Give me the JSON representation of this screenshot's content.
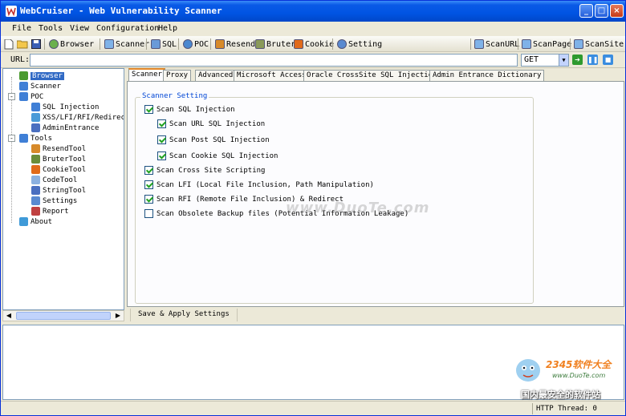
{
  "window": {
    "title": "WebCruiser - Web Vulnerability Scanner",
    "min": "_",
    "max": "□",
    "close": "×"
  },
  "menu": [
    "File",
    "Tools",
    "View",
    "Configuration",
    "Help"
  ],
  "toolbar": {
    "browser": "Browser",
    "scanner": "Scanner",
    "sql": "SQL",
    "poc": "POC",
    "resend": "Resend",
    "bruter": "Bruter",
    "cookie": "Cookie",
    "setting": "Setting",
    "scanurl": "ScanURL",
    "scanpage": "ScanPage",
    "scansite": "ScanSite"
  },
  "urlbar": {
    "label": "URL:",
    "value": "",
    "method": "GET"
  },
  "tree": [
    {
      "label": "Browser",
      "level": 0,
      "selected": true,
      "icon": "browser-icon",
      "color": "#4a9a2e"
    },
    {
      "label": "Scanner",
      "level": 0,
      "icon": "scanner-icon",
      "color": "#3f7fd6"
    },
    {
      "label": "POC",
      "level": 0,
      "expand": "-",
      "icon": "poc-icon",
      "color": "#3f7fd6"
    },
    {
      "label": "SQL Injection",
      "level": 1,
      "icon": "sql-icon",
      "color": "#3f7fd6"
    },
    {
      "label": "XSS/LFI/RFI/Redirect",
      "level": 1,
      "icon": "xss-icon",
      "color": "#4a9ad8"
    },
    {
      "label": "AdminEntrance",
      "level": 1,
      "icon": "admin-icon",
      "color": "#4a6fc0"
    },
    {
      "label": "Tools",
      "level": 0,
      "expand": "-",
      "icon": "tools-icon",
      "color": "#3f7fd6"
    },
    {
      "label": "ResendTool",
      "level": 1,
      "icon": "resend-icon",
      "color": "#d78a2a"
    },
    {
      "label": "BruterTool",
      "level": 1,
      "icon": "bruter-icon",
      "color": "#6a8d3a"
    },
    {
      "label": "CookieTool",
      "level": 1,
      "icon": "cookie-icon",
      "color": "#e06a1a"
    },
    {
      "label": "CodeTool",
      "level": 1,
      "icon": "code-icon",
      "color": "#8bb0e0"
    },
    {
      "label": "StringTool",
      "level": 1,
      "icon": "string-icon",
      "color": "#4a6fc0"
    },
    {
      "label": "Settings",
      "level": 1,
      "icon": "settings-icon",
      "color": "#5a8ad0"
    },
    {
      "label": "Report",
      "level": 1,
      "icon": "report-icon",
      "color": "#c04040"
    },
    {
      "label": "About",
      "level": 0,
      "icon": "about-icon",
      "color": "#3f9ad8"
    }
  ],
  "tabs": [
    "Scanner",
    "Proxy",
    "Advanced",
    "Microsoft Access",
    "Oracle CrossSite SQL Injection",
    "Admin Entrance Dictionary"
  ],
  "scanner_setting": {
    "legend": "Scanner Setting",
    "options": [
      {
        "label": "Scan SQL Injection",
        "checked": true,
        "indent": 0
      },
      {
        "label": "Scan URL SQL Injection",
        "checked": true,
        "indent": 1
      },
      {
        "label": "Scan Post SQL Injection",
        "checked": true,
        "indent": 1
      },
      {
        "label": "Scan Cookie SQL Injection",
        "checked": true,
        "indent": 1
      },
      {
        "label": "Scan Cross Site Scripting",
        "checked": true,
        "indent": 0
      },
      {
        "label": "Scan LFI (Local File Inclusion, Path Manipulation)",
        "checked": true,
        "indent": 0
      },
      {
        "label": "Scan RFI (Remote File Inclusion) & Redirect",
        "checked": true,
        "indent": 0
      },
      {
        "label": "Scan Obsolete Backup files (Potential Information Leakage)",
        "checked": false,
        "indent": 0
      }
    ]
  },
  "apply_button": "Save & Apply Settings",
  "status": "HTTP Thread: 0",
  "watermark": {
    "center": "www.DuoTe.com",
    "brand": "2345软件大全",
    "url": "www.DuoTe.com",
    "slogan": "国内最安全的软件站"
  }
}
